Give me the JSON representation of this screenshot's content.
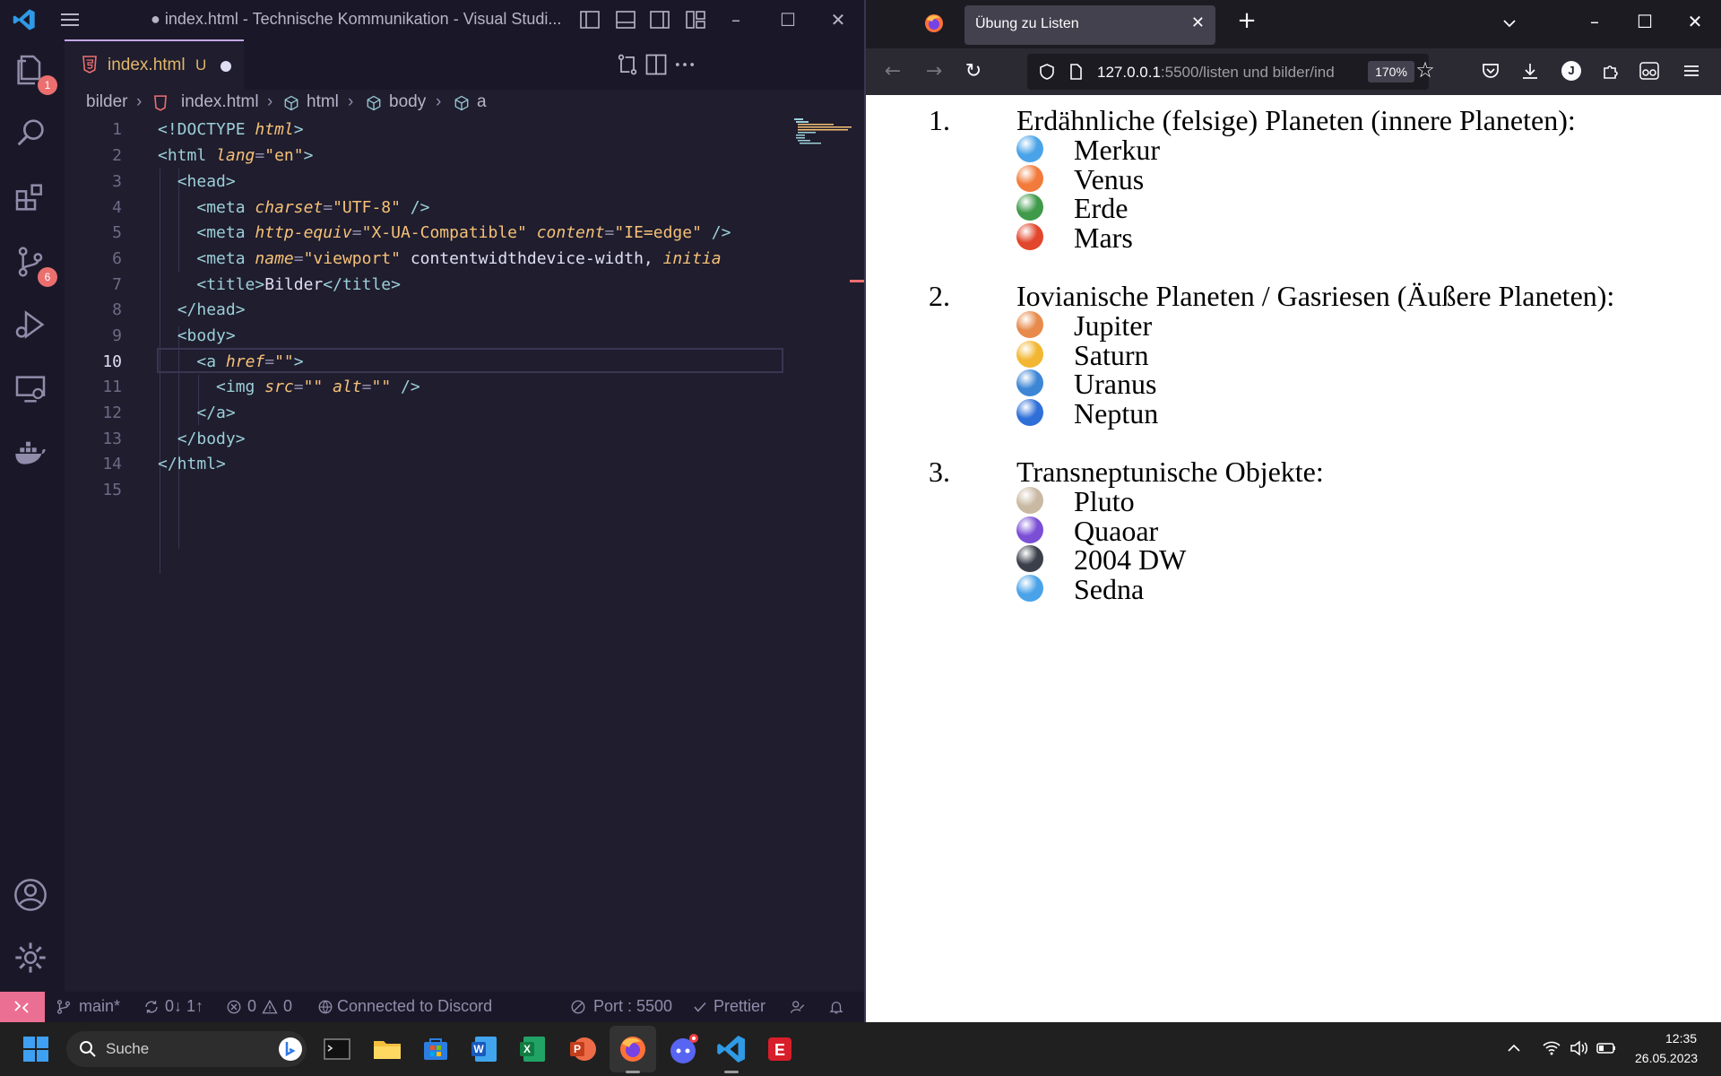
{
  "vscode": {
    "title": "● index.html - Technische Kommunikation - Visual Studi...",
    "tab": {
      "name": "index.html",
      "status": "U"
    },
    "activity_badges": {
      "explorer": "1",
      "scm": "6"
    },
    "breadcrumb": [
      "bilder",
      "index.html",
      "html",
      "body",
      "a"
    ],
    "line_numbers": [
      "1",
      "2",
      "3",
      "4",
      "5",
      "6",
      "7",
      "8",
      "9",
      "10",
      "11",
      "12",
      "13",
      "14",
      "15"
    ],
    "code": [
      "<!DOCTYPE html>",
      "<html lang=\"en\">",
      "  <head>",
      "    <meta charset=\"UTF-8\" />",
      "    <meta http-equiv=\"X-UA-Compatible\" content=\"IE=edge\" />",
      "    <meta name=\"viewport\" content=\"width=device-width, initia",
      "    <title>Bilder</title>",
      "  </head>",
      "  <body>",
      "    <a href=\"\">",
      "      <img src=\"\" alt=\"\" />",
      "    </a>",
      "  </body>",
      "</html>",
      ""
    ],
    "status": {
      "branch": "main*",
      "sync": "0↓ 1↑",
      "errors": "0",
      "warnings": "0",
      "discord": "Connected to Discord",
      "port": "Port : 5500",
      "prettier": "Prettier"
    }
  },
  "firefox": {
    "tab_title": "Übung zu Listen",
    "url_host": "127.0.0.1",
    "url_rest": ":5500/listen und bilder/ind",
    "zoom": "170%",
    "profile_initial": "J",
    "lists": [
      {
        "number": "1.",
        "title": "Erdähnliche (felsige) Planeten (innere Planeten):",
        "items": [
          {
            "name": "Merkur",
            "color": "#4aa3e8"
          },
          {
            "name": "Venus",
            "color": "#f27a3a"
          },
          {
            "name": "Erde",
            "color": "#3f9a4a"
          },
          {
            "name": "Mars",
            "color": "#e2462c"
          }
        ]
      },
      {
        "number": "2.",
        "title": "Iovianische Planeten / Gasriesen (Äußere Planeten):",
        "items": [
          {
            "name": "Jupiter",
            "color": "#e78a4b"
          },
          {
            "name": "Saturn",
            "color": "#f2b632"
          },
          {
            "name": "Uranus",
            "color": "#3d86d6"
          },
          {
            "name": "Neptun",
            "color": "#2f6fd8"
          }
        ]
      },
      {
        "number": "3.",
        "title": "Transneptunische Objekte:",
        "items": [
          {
            "name": "Pluto",
            "color": "#c9b9a3"
          },
          {
            "name": "Quaoar",
            "color": "#7a4fd6"
          },
          {
            "name": "2004 DW",
            "color": "#3a3f4a"
          },
          {
            "name": "Sedna",
            "color": "#4aa3e8"
          }
        ]
      }
    ]
  },
  "taskbar": {
    "search_label": "Suche",
    "time": "12:35",
    "date": "26.05.2023"
  }
}
